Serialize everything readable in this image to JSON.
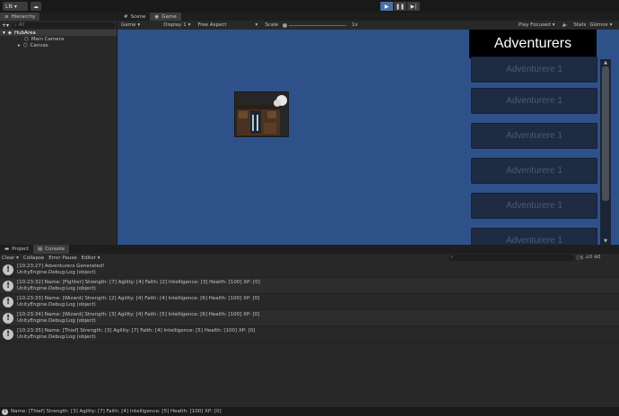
{
  "toolbar": {
    "account_label": "LN",
    "play_icon": "play-icon",
    "pause_icon": "pause-icon",
    "step_icon": "step-icon"
  },
  "hierarchy": {
    "tab_label": "Hierarchy",
    "search_placeholder": "All",
    "items": [
      {
        "label": "HubArea",
        "level": 0
      },
      {
        "label": "Main Camera",
        "level": 1
      },
      {
        "label": "Canvas",
        "level": 1
      }
    ]
  },
  "view_tabs": [
    {
      "label": "Scene",
      "active": false
    },
    {
      "label": "Game",
      "active": true
    }
  ],
  "game_toolbar": {
    "mode": "Game",
    "display": "Display 1",
    "aspect": "Free Aspect",
    "scale_label": "Scale",
    "scale_value": "1x",
    "play_focused": "Play Focused",
    "stats": "Stats",
    "gizmos": "Gizmos"
  },
  "game": {
    "header": "Adventurers",
    "cards": [
      "Adventurere 1",
      "Adventurere 1",
      "Adventurere 1",
      "Adventurere 1",
      "Adventurere 1",
      "Adventurere 1"
    ]
  },
  "console_tabs": [
    {
      "label": "Project",
      "active": false
    },
    {
      "label": "Console",
      "active": true
    }
  ],
  "console_toolbar": {
    "clear": "Clear",
    "collapse": "Collapse",
    "error_pause": "Error Pause",
    "editor": "Editor",
    "log_count": "5",
    "warn_count": "0",
    "error_count": "0"
  },
  "logs": [
    {
      "line1": "[10:23:27] Adventurers Generated!",
      "line2": "UnityEngine.Debug:Log (object)"
    },
    {
      "line1": "[10:23:32] Name: [Fighter] Strength: [7]  Agility: [4] Faith: [2] Intelligence: [3] Health: [100] XP: [0]",
      "line2": "UnityEngine.Debug:Log (object)"
    },
    {
      "line1": "[10:23:33] Name: [Wizard] Strength: [2]  Agility: [4] Faith: [4] Intelligence: [6] Health: [100] XP: [0]",
      "line2": "UnityEngine.Debug:Log (object)"
    },
    {
      "line1": "[10:23:34] Name: [Wizard] Strength: [3]  Agility: [4] Faith: [5] Intelligence: [6] Health: [100] XP: [0]",
      "line2": "UnityEngine.Debug:Log (object)"
    },
    {
      "line1": "[10:23:35] Name: [Thief] Strength: [3]  Agility: [7] Faith: [4] Intelligence: [5] Health: [100] XP: [0]",
      "line2": "UnityEngine.Debug:Log (object)"
    }
  ],
  "status": {
    "text": "Name: [Thief] Strength: [3]  Agility: [7] Faith: [4] Intelligence: [5] Health: [100] XP: [0]"
  }
}
